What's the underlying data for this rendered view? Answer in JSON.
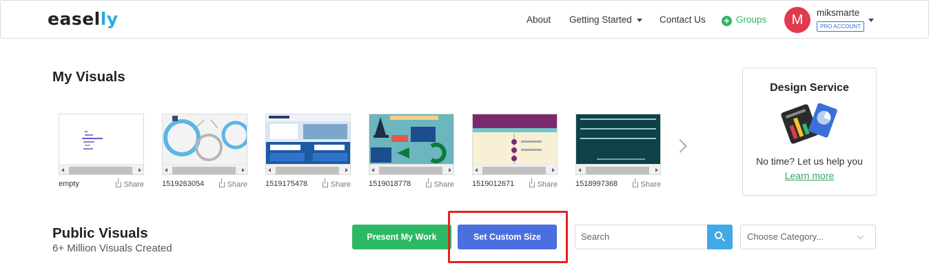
{
  "header": {
    "logo_main": "easel",
    "logo_accent": "ly",
    "nav": {
      "about": "About",
      "getting_started": "Getting Started",
      "contact": "Contact Us",
      "groups": "Groups"
    },
    "user": {
      "initial": "M",
      "name": "miksmarte",
      "badge": "PRO ACCOUNT"
    }
  },
  "my_visuals": {
    "title": "My Visuals",
    "share_label": "Share",
    "items": [
      {
        "name": "empty"
      },
      {
        "name": "1519263054"
      },
      {
        "name": "1519175478"
      },
      {
        "name": "1519018778"
      },
      {
        "name": "1519012671"
      },
      {
        "name": "1518997368"
      }
    ]
  },
  "design_service": {
    "title": "Design Service",
    "text": "No time? Let us help you",
    "link": "Learn more"
  },
  "public_visuals": {
    "title": "Public Visuals",
    "subtitle": "6+ Million Visuals Created",
    "present_button": "Present My Work",
    "custom_size_button": "Set Custom Size",
    "search_placeholder": "Search",
    "category_placeholder": "Choose Category..."
  },
  "colors": {
    "green": "#2db866",
    "blue": "#4a6fde",
    "search_blue": "#40a9e6",
    "highlight_red": "#e8201f",
    "avatar_red": "#e2394c"
  }
}
